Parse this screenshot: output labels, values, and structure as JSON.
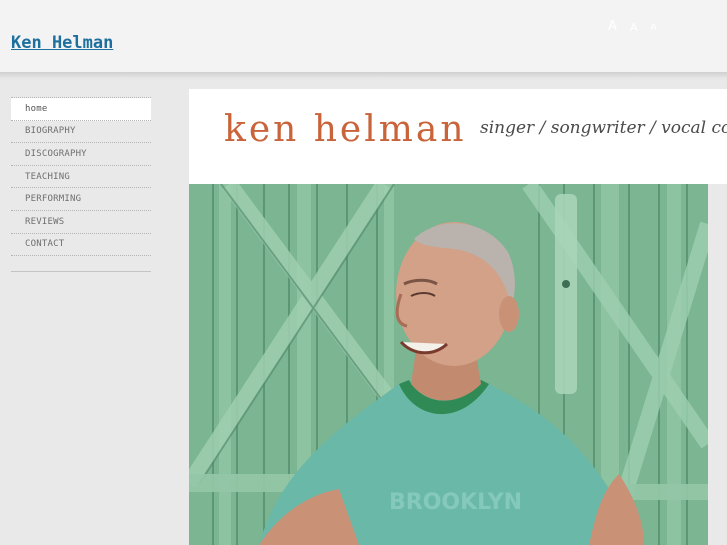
{
  "header": {
    "site_title": "Ken Helman",
    "font_size_controls": [
      "A",
      "A",
      "A"
    ]
  },
  "sidebar": {
    "items": [
      {
        "label": "home",
        "active": true
      },
      {
        "label": "BIOGRAPHY",
        "active": false
      },
      {
        "label": "DISCOGRAPHY",
        "active": false
      },
      {
        "label": "TEACHING",
        "active": false
      },
      {
        "label": "PERFORMING",
        "active": false
      },
      {
        "label": "REVIEWS",
        "active": false
      },
      {
        "label": "CONTACT",
        "active": false
      }
    ]
  },
  "banner": {
    "name": "ken helman",
    "tagline": "singer / songwriter / vocal coach"
  },
  "photo": {
    "shirt_text": "BROOKLYN"
  },
  "colors": {
    "title_link": "#1d6f9e",
    "banner_name": "#c9643a",
    "background": "#e9e9e9",
    "door_green": "#78b08f",
    "shirt": "#6ab8a8"
  }
}
